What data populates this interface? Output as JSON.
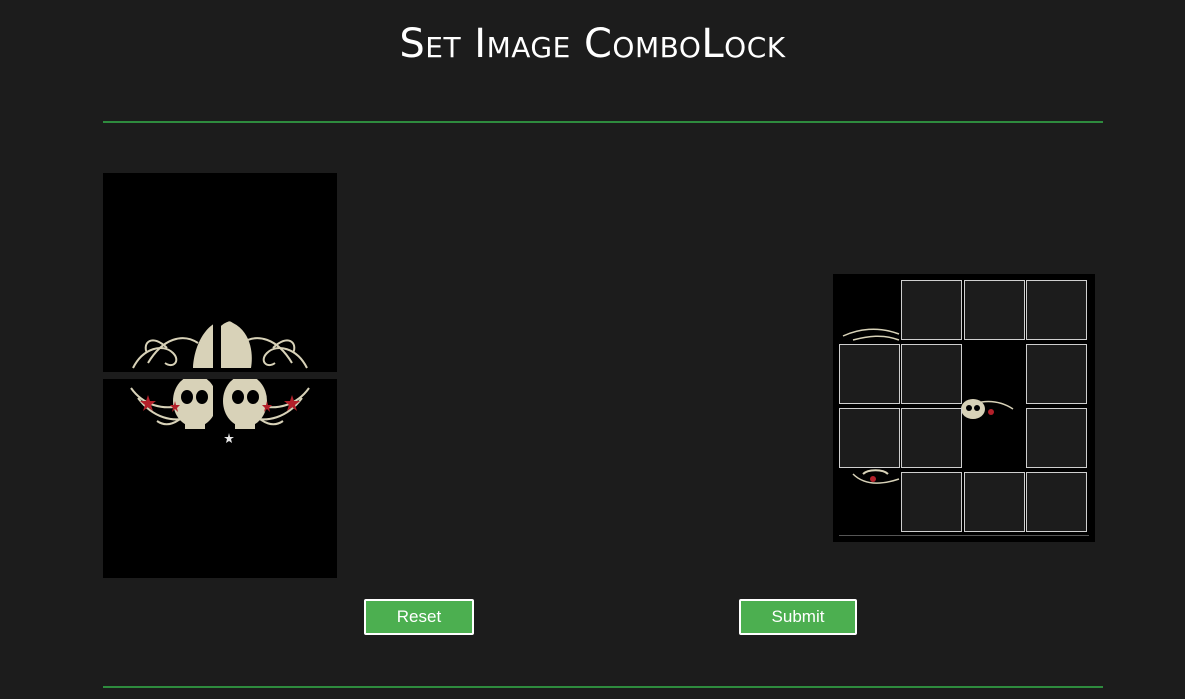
{
  "page": {
    "title": "Set Image ComboLock"
  },
  "preview": {
    "image_icon": "skull-ornament-image"
  },
  "lock_grid": {
    "rows": 4,
    "columns": 4,
    "tiles": [
      {
        "row": 0,
        "col": 0,
        "state": "revealed"
      },
      {
        "row": 0,
        "col": 1,
        "state": "hidden"
      },
      {
        "row": 0,
        "col": 2,
        "state": "hidden"
      },
      {
        "row": 0,
        "col": 3,
        "state": "hidden"
      },
      {
        "row": 1,
        "col": 0,
        "state": "hidden"
      },
      {
        "row": 1,
        "col": 1,
        "state": "hidden"
      },
      {
        "row": 1,
        "col": 2,
        "state": "revealed"
      },
      {
        "row": 1,
        "col": 3,
        "state": "hidden"
      },
      {
        "row": 2,
        "col": 0,
        "state": "hidden"
      },
      {
        "row": 2,
        "col": 1,
        "state": "hidden"
      },
      {
        "row": 2,
        "col": 2,
        "state": "revealed"
      },
      {
        "row": 2,
        "col": 3,
        "state": "hidden"
      },
      {
        "row": 3,
        "col": 0,
        "state": "revealed"
      },
      {
        "row": 3,
        "col": 1,
        "state": "hidden"
      },
      {
        "row": 3,
        "col": 2,
        "state": "hidden"
      },
      {
        "row": 3,
        "col": 3,
        "state": "hidden"
      }
    ]
  },
  "buttons": {
    "reset_label": "Reset",
    "submit_label": "Submit"
  },
  "colors": {
    "background": "#1c1c1c",
    "accent_green": "#4caf50",
    "rule_green": "#2e8b3e",
    "tile_border": "#cfcfcf"
  }
}
